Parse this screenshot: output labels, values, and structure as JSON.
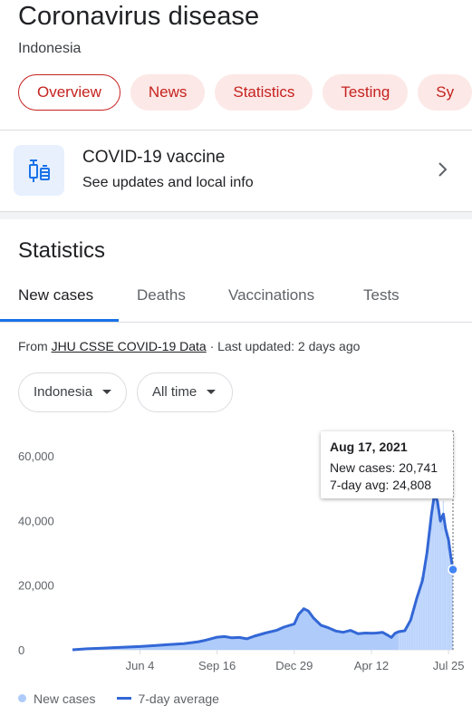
{
  "header": {
    "title": "Coronavirus disease",
    "subtitle": "Indonesia"
  },
  "chips": [
    {
      "label": "Overview",
      "active": true
    },
    {
      "label": "News",
      "active": false
    },
    {
      "label": "Statistics",
      "active": false
    },
    {
      "label": "Testing",
      "active": false
    },
    {
      "label": "Sy",
      "active": false
    }
  ],
  "vaccine": {
    "title": "COVID-19 vaccine",
    "subtitle": "See updates and local info",
    "icon": "vaccine-icon"
  },
  "statistics": {
    "heading": "Statistics",
    "tabs": [
      "New cases",
      "Deaths",
      "Vaccinations",
      "Tests"
    ],
    "active_tab": "New cases",
    "source_prefix": "From ",
    "source_link": "JHU CSSE COVID-19 Data",
    "source_suffix": " · Last updated: 2 days ago",
    "location_dropdown": "Indonesia",
    "range_dropdown": "All time"
  },
  "tooltip": {
    "date": "Aug 17, 2021",
    "new_cases": "New cases: 20,741",
    "avg": "7-day avg: 24,808"
  },
  "legend": {
    "bars": "New cases",
    "line": "7-day average"
  },
  "colors": {
    "accent_red": "#c5221f",
    "chip_bg": "#fce8e6",
    "blue": "#3367d6",
    "bar_blue": "#aecbfa"
  },
  "chart_data": {
    "type": "area",
    "title": "",
    "xlabel": "",
    "ylabel": "",
    "ylim": [
      0,
      60000
    ],
    "y_ticks": [
      0,
      20000,
      40000,
      60000
    ],
    "y_tick_labels": [
      "0",
      "20,000",
      "40,000",
      "60,000"
    ],
    "x_tick_labels": [
      "Jun 4",
      "Sep 16",
      "Dec 29",
      "Apr 12",
      "Jul 25"
    ],
    "x_ticks_day": [
      91,
      195,
      299,
      403,
      507
    ],
    "x_range_day": [
      0,
      513
    ],
    "grid": false,
    "legend_position": "bottom-left",
    "series": [
      {
        "name": "7-day average",
        "points": [
          [
            0,
            0
          ],
          [
            20,
            300
          ],
          [
            40,
            500
          ],
          [
            60,
            700
          ],
          [
            80,
            900
          ],
          [
            91,
            1000
          ],
          [
            110,
            1300
          ],
          [
            130,
            1600
          ],
          [
            150,
            1900
          ],
          [
            170,
            2500
          ],
          [
            180,
            3000
          ],
          [
            195,
            3900
          ],
          [
            205,
            4100
          ],
          [
            215,
            3700
          ],
          [
            225,
            3800
          ],
          [
            235,
            3400
          ],
          [
            245,
            4200
          ],
          [
            260,
            5200
          ],
          [
            275,
            6000
          ],
          [
            285,
            7000
          ],
          [
            299,
            8000
          ],
          [
            305,
            11000
          ],
          [
            312,
            12700
          ],
          [
            318,
            12000
          ],
          [
            325,
            9800
          ],
          [
            335,
            7600
          ],
          [
            345,
            6800
          ],
          [
            355,
            5800
          ],
          [
            365,
            5400
          ],
          [
            375,
            6000
          ],
          [
            385,
            5000
          ],
          [
            395,
            5200
          ],
          [
            403,
            5100
          ],
          [
            410,
            5200
          ],
          [
            418,
            5400
          ],
          [
            425,
            4500
          ],
          [
            430,
            3800
          ],
          [
            435,
            5100
          ],
          [
            440,
            5600
          ],
          [
            448,
            5900
          ],
          [
            456,
            9200
          ],
          [
            464,
            15800
          ],
          [
            472,
            21500
          ],
          [
            478,
            30000
          ],
          [
            484,
            42000
          ],
          [
            488,
            48000
          ],
          [
            492,
            46000
          ],
          [
            496,
            39800
          ],
          [
            500,
            42000
          ],
          [
            503,
            37500
          ],
          [
            507,
            34000
          ],
          [
            510,
            29000
          ],
          [
            513,
            24808
          ]
        ]
      }
    ]
  }
}
